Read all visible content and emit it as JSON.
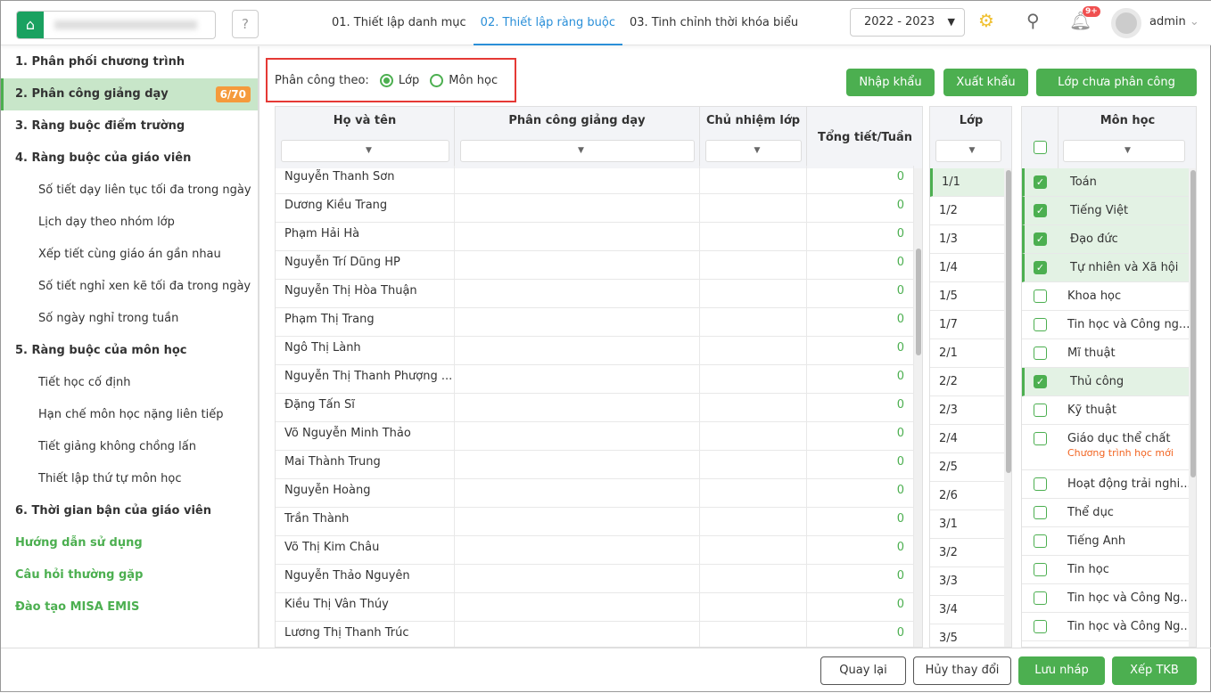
{
  "header": {
    "steps": [
      "01. Thiết lập danh mục",
      "02. Thiết lập ràng buộc",
      "03. Tinh chỉnh thời khóa biểu"
    ],
    "year": "2022 - 2023",
    "notif_badge": "9+",
    "user": "admin"
  },
  "sidebar": {
    "items": [
      {
        "label": "1. Phân phối chương trình",
        "type": "b"
      },
      {
        "label": "2. Phân công giảng dạy",
        "type": "b active",
        "badge": "6/70"
      },
      {
        "label": "3. Ràng buộc điểm trường",
        "type": "b"
      },
      {
        "label": "4. Ràng buộc của giáo viên",
        "type": "b"
      },
      {
        "label": "Số tiết dạy liên tục tối đa trong ngày",
        "type": "sub"
      },
      {
        "label": "Lịch dạy theo nhóm lớp",
        "type": "sub"
      },
      {
        "label": "Xếp tiết cùng giáo án gần nhau",
        "type": "sub"
      },
      {
        "label": "Số tiết nghỉ xen kẽ tối đa trong ngày",
        "type": "sub"
      },
      {
        "label": "Số ngày nghỉ trong tuần",
        "type": "sub"
      },
      {
        "label": "5. Ràng buộc của môn học",
        "type": "b"
      },
      {
        "label": "Tiết học cố định",
        "type": "sub"
      },
      {
        "label": "Hạn chế môn học nặng liên tiếp",
        "type": "sub"
      },
      {
        "label": "Tiết giảng không chồng lấn",
        "type": "sub"
      },
      {
        "label": "Thiết lập thứ tự môn học",
        "type": "sub"
      },
      {
        "label": "6. Thời gian bận của giáo viên",
        "type": "b"
      },
      {
        "label": "Hướng dẫn sử dụng",
        "type": "link"
      },
      {
        "label": "Câu hỏi thường gặp",
        "type": "link"
      },
      {
        "label": "Đào tạo MISA EMIS",
        "type": "link"
      }
    ]
  },
  "filter": {
    "label": "Phân công theo:",
    "options": [
      "Lớp",
      "Môn học"
    ],
    "selected": "Lớp"
  },
  "actions": {
    "import": "Nhập khẩu",
    "export": "Xuất khẩu",
    "unassigned": "Lớp chưa phân công"
  },
  "teachers": {
    "columns": [
      "Họ và tên",
      "Phân công giảng dạy",
      "Chủ nhiệm lớp",
      "Tổng tiết/Tuần"
    ],
    "rows": [
      [
        "Nguyễn Thanh Sơn",
        "0"
      ],
      [
        "Dương Kiều Trang",
        "0"
      ],
      [
        "Phạm Hải Hà",
        "0"
      ],
      [
        "Nguyễn Trí Dũng HP",
        "0"
      ],
      [
        "Nguyễn Thị Hòa Thuận",
        "0"
      ],
      [
        "Phạm Thị Trang",
        "0"
      ],
      [
        "Ngô Thị Lành",
        "0"
      ],
      [
        "Nguyễn Thị Thanh Phượng ...",
        "0"
      ],
      [
        "Đặng Tấn Sĩ",
        "0"
      ],
      [
        "Võ Nguyễn Minh Thảo",
        "0"
      ],
      [
        "Mai Thành Trung",
        "0"
      ],
      [
        "Nguyễn Hoàng",
        "0"
      ],
      [
        "Trần Thành",
        "0"
      ],
      [
        "Võ Thị Kim Châu",
        "0"
      ],
      [
        "Nguyễn Thảo Nguyên",
        "0"
      ],
      [
        "Kiều Thị Vân Thúy",
        "0"
      ],
      [
        "Lương Thị Thanh Trúc",
        "0"
      ]
    ]
  },
  "classes": {
    "column": "Lớp",
    "rows": [
      "1/1",
      "1/2",
      "1/3",
      "1/4",
      "1/5",
      "1/7",
      "2/1",
      "2/2",
      "2/3",
      "2/4",
      "2/5",
      "2/6",
      "3/1",
      "3/2",
      "3/3",
      "3/4",
      "3/5"
    ],
    "selected": "1/1"
  },
  "subjects": {
    "column": "Môn học",
    "rows": [
      {
        "name": "Toán",
        "checked": true
      },
      {
        "name": "Tiếng Việt",
        "checked": true
      },
      {
        "name": "Đạo đức",
        "checked": true
      },
      {
        "name": "Tự nhiên và Xã hội",
        "checked": true
      },
      {
        "name": "Khoa học",
        "checked": false
      },
      {
        "name": "Tin học và Công ng...",
        "checked": false
      },
      {
        "name": "Mĩ thuật",
        "checked": false
      },
      {
        "name": "Thủ công",
        "checked": true
      },
      {
        "name": "Kỹ thuật",
        "checked": false
      },
      {
        "name": "Giáo dục thể chất",
        "checked": false,
        "note": "Chương trình học mới"
      },
      {
        "name": "Hoạt động trải nghi...",
        "checked": false
      },
      {
        "name": "Thể dục",
        "checked": false
      },
      {
        "name": "Tiếng Anh",
        "checked": false
      },
      {
        "name": "Tin học",
        "checked": false
      },
      {
        "name": "Tin học và Công Ng...",
        "checked": false
      },
      {
        "name": "Tin học và Công Ng...",
        "checked": false
      }
    ]
  },
  "footer": {
    "back": "Quay lại",
    "cancel": "Hủy thay đổi",
    "save_draft": "Lưu nháp",
    "schedule": "Xếp TKB"
  },
  "colors": {
    "accent": "#4caf50",
    "link": "#2a8fd8",
    "badge": "#f59a3c",
    "highlight": "#e3f2e4"
  }
}
